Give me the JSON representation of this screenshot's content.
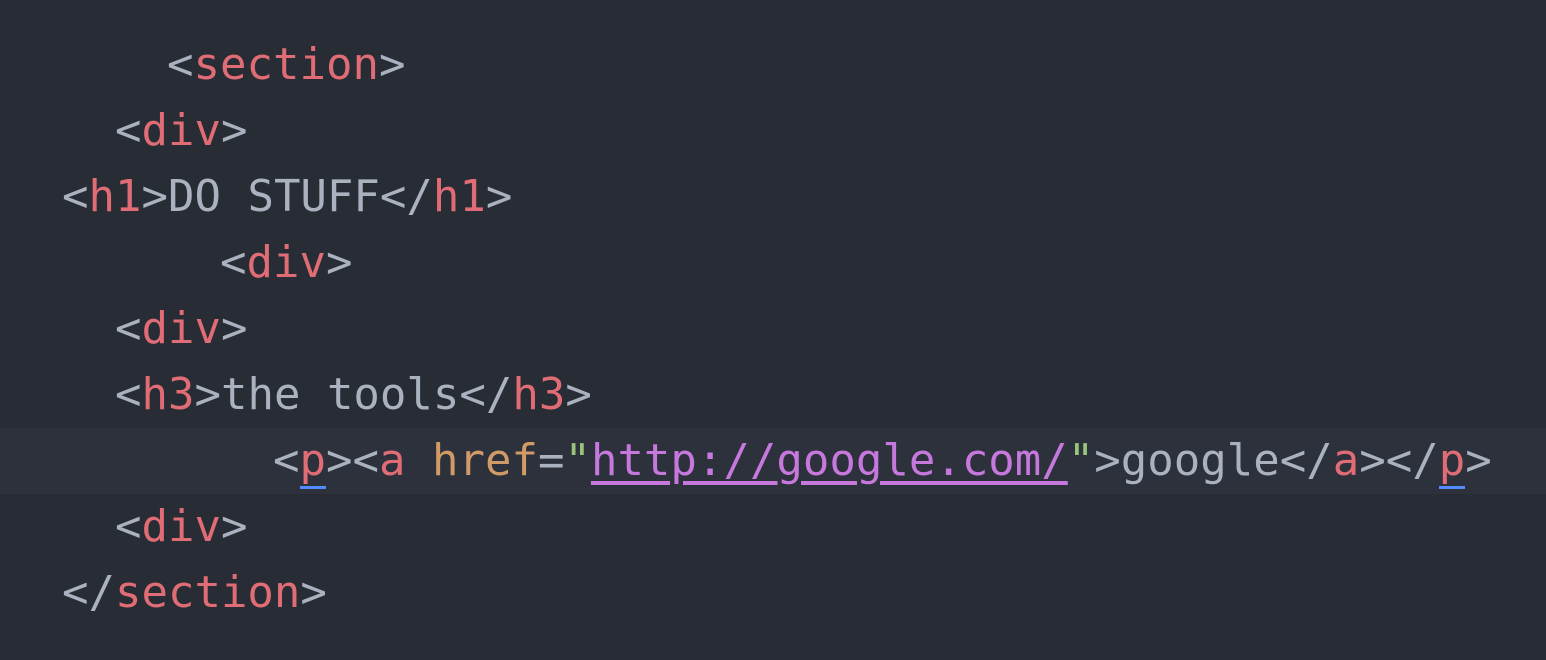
{
  "editor": {
    "theme_colors": {
      "background": "#282c34",
      "current_line": "#2c313c",
      "punctuation": "#abb2bf",
      "tag_name": "#e06c75",
      "attribute": "#d19a66",
      "string_quote": "#98c379",
      "url": "#c678dd",
      "bracket_match_underline": "#528bff"
    },
    "lines": [
      {
        "tag": "section"
      },
      {
        "tag": "div"
      },
      {
        "tag_open": "h1",
        "text": "DO STUFF",
        "tag_close": "h1"
      },
      {
        "tag": "div"
      },
      {
        "tag": "div"
      },
      {
        "tag_open": "h3",
        "text": "the tools",
        "tag_close": "h3"
      },
      {
        "p_tag": "p",
        "a_tag": "a",
        "attr_name": "href",
        "equals": "=",
        "quote": "\"",
        "url": "http://google.com/",
        "link_text": "google",
        "a_close": "a",
        "p_close": "p"
      },
      {
        "tag": "div"
      },
      {
        "tag_close": "section"
      }
    ]
  }
}
